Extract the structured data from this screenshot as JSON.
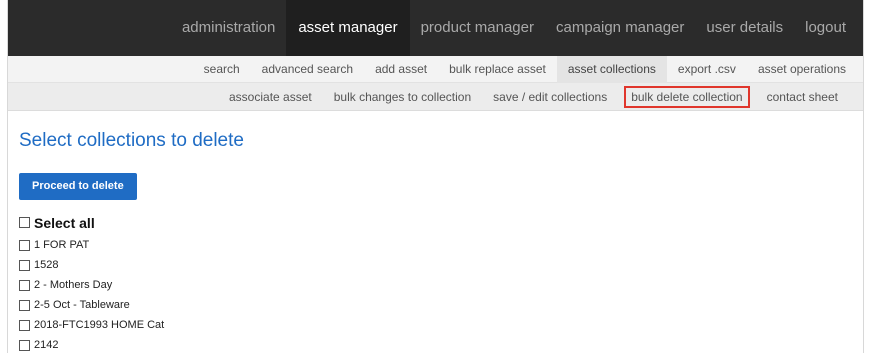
{
  "topnav": {
    "items": [
      {
        "label": "administration",
        "active": false
      },
      {
        "label": "asset manager",
        "active": true
      },
      {
        "label": "product manager",
        "active": false
      },
      {
        "label": "campaign manager",
        "active": false
      },
      {
        "label": "user details",
        "active": false
      },
      {
        "label": "logout",
        "active": false
      }
    ]
  },
  "subnav": {
    "items": [
      {
        "label": "search"
      },
      {
        "label": "advanced search"
      },
      {
        "label": "add asset"
      },
      {
        "label": "bulk replace asset"
      },
      {
        "label": "asset collections",
        "active": true
      },
      {
        "label": "export .csv"
      },
      {
        "label": "asset operations"
      }
    ]
  },
  "subnav2": {
    "items": [
      {
        "label": "associate asset"
      },
      {
        "label": "bulk changes to collection"
      },
      {
        "label": "save / edit collections"
      },
      {
        "label": "bulk delete collection",
        "highlighted": true
      },
      {
        "label": "contact sheet"
      }
    ]
  },
  "page": {
    "title": "Select collections to delete",
    "proceed_label": "Proceed to delete",
    "select_all_label": "Select all"
  },
  "collections": [
    "1 FOR PAT",
    "1528",
    "2 - Mothers Day",
    "2-5 Oct - Tableware",
    "2018-FTC1993 HOME Cat",
    "2142"
  ],
  "colors": {
    "accent": "#1f6cc4",
    "topbar": "#2b2b2b",
    "highlight_border": "#e0362c"
  }
}
